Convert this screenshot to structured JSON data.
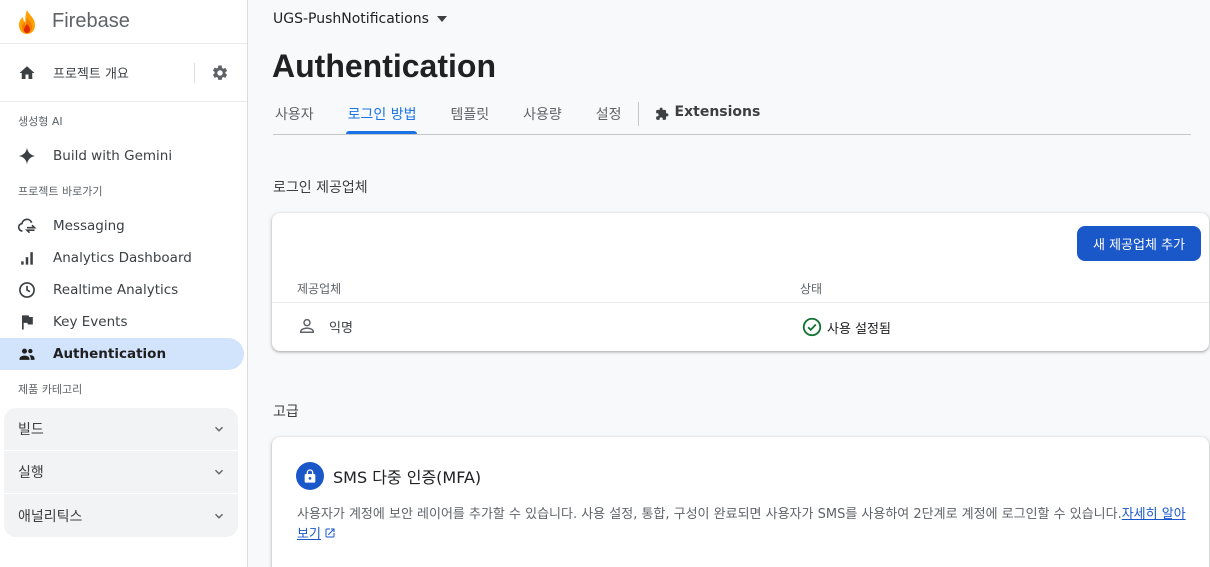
{
  "brand": {
    "name": "Firebase"
  },
  "sidebar": {
    "overview_label": "프로젝트 개요",
    "section_ai": "생성형 AI",
    "ai_items": [
      {
        "label": "Build with Gemini",
        "icon": "sparkle-icon"
      }
    ],
    "section_shortcuts": "프로젝트 바로가기",
    "shortcut_items": [
      {
        "label": "Messaging",
        "icon": "cloud-sync-icon"
      },
      {
        "label": "Analytics Dashboard",
        "icon": "bar-chart-icon"
      },
      {
        "label": "Realtime Analytics",
        "icon": "clock-icon"
      },
      {
        "label": "Key Events",
        "icon": "flag-icon"
      },
      {
        "label": "Authentication",
        "icon": "people-icon",
        "active": true
      }
    ],
    "section_categories": "제품 카테고리",
    "categories": [
      {
        "label": "빌드"
      },
      {
        "label": "실행"
      },
      {
        "label": "애널리틱스"
      }
    ]
  },
  "header": {
    "project_name": "UGS-PushNotifications",
    "page_title": "Authentication",
    "tabs": [
      {
        "label": "사용자"
      },
      {
        "label": "로그인 방법",
        "active": true
      },
      {
        "label": "템플릿"
      },
      {
        "label": "사용량"
      },
      {
        "label": "설정"
      },
      {
        "label": "Extensions",
        "icon": "extensions-icon"
      }
    ]
  },
  "providers": {
    "section_title": "로그인 제공업체",
    "add_button": "새 제공업체 추가",
    "columns": {
      "provider": "제공업체",
      "status": "상태"
    },
    "rows": [
      {
        "provider": "익명",
        "status": "사용 설정됨",
        "icon": "person-icon"
      }
    ]
  },
  "advanced": {
    "section_title": "고급",
    "mfa_title": "SMS 다중 인증(MFA)",
    "mfa_desc": "사용자가 계정에 보안 레이어를 추가할 수 있습니다. 사용 설정, 통합, 구성이 완료되면 사용자가 SMS를 사용하여 2단계로 계정에 로그인할 수 있습니다.",
    "mfa_link": "자세히 알아보기"
  },
  "colors": {
    "accent": "#1a73e8",
    "button": "#1a57c9",
    "active_nav_bg": "#d2e3fc",
    "status_ok": "#137333"
  }
}
